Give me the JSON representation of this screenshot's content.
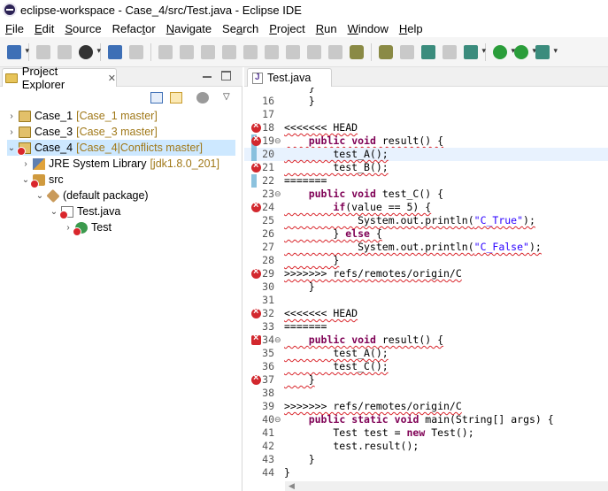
{
  "window": {
    "title": "eclipse-workspace - Case_4/src/Test.java - Eclipse IDE"
  },
  "menu": [
    {
      "mn": "F",
      "rest": "ile"
    },
    {
      "mn": "E",
      "rest": "dit"
    },
    {
      "mn": "S",
      "rest": "ource"
    },
    {
      "pre": "Refac",
      "mn": "t",
      "rest": "or"
    },
    {
      "mn": "N",
      "rest": "avigate"
    },
    {
      "pre": "Se",
      "mn": "a",
      "rest": "rch"
    },
    {
      "mn": "P",
      "rest": "roject"
    },
    {
      "mn": "R",
      "rest": "un"
    },
    {
      "mn": "W",
      "rest": "indow"
    },
    {
      "mn": "H",
      "rest": "elp"
    }
  ],
  "toolbar": {
    "icons": [
      "new-icon",
      "save-icon",
      "save-all-icon",
      "profile-icon",
      "terminal-icon",
      "skip-breakpoints-icon",
      "resume-icon",
      "suspend-icon",
      "terminate-icon",
      "disconnect-icon",
      "step-into-icon",
      "step-over-icon",
      "step-return-icon",
      "drop-to-frame-icon",
      "use-step-filters-icon",
      "open-type-icon",
      "toggle-mark-icon",
      "search-icon",
      "annotation-icon",
      "show-whitespace-icon",
      "debug-icon",
      "run-icon",
      "coverage-icon",
      "external-tools-icon"
    ]
  },
  "project_explorer": {
    "tab_label": "Project Explorer",
    "close_glyph": "✕",
    "tree": [
      {
        "depth": 0,
        "arrow": "›",
        "icon": "project-icon",
        "label": "Case_1",
        "decor": "[Case_1 master]"
      },
      {
        "depth": 0,
        "arrow": "›",
        "icon": "project-icon",
        "label": "Case_3",
        "decor": "[Case_3 master]"
      },
      {
        "depth": 0,
        "arrow": "⌄",
        "icon": "project-error-icon",
        "label": "Case_4",
        "decor": "[Case_4|Conflicts master]",
        "selected": true
      },
      {
        "depth": 1,
        "arrow": "›",
        "icon": "library-icon",
        "label": "JRE System Library",
        "decor": "[jdk1.8.0_201]"
      },
      {
        "depth": 1,
        "arrow": "⌄",
        "icon": "source-folder-icon",
        "label": "src",
        "decor": ""
      },
      {
        "depth": 2,
        "arrow": "⌄",
        "icon": "package-icon",
        "label": "(default package)",
        "decor": ""
      },
      {
        "depth": 3,
        "arrow": "⌄",
        "icon": "java-file-icon",
        "label": "Test.java",
        "decor": ""
      },
      {
        "depth": 4,
        "arrow": "›",
        "icon": "class-icon",
        "label": "Test",
        "decor": ""
      }
    ]
  },
  "editor": {
    "tab_label": "Test.java",
    "lines": [
      {
        "n": "",
        "text": "    }",
        "marker": ""
      },
      {
        "n": "16",
        "text": "    }",
        "marker": ""
      },
      {
        "n": "17",
        "text": "",
        "marker": ""
      },
      {
        "n": "18",
        "text": "<<<<<<< HEAD",
        "marker": "error",
        "style": "conflict"
      },
      {
        "n": "19",
        "text": "    public void result() {",
        "marker": "error-bar",
        "fold": "⊖"
      },
      {
        "n": "20",
        "text": "        test_A();",
        "marker": "bar",
        "cur": true
      },
      {
        "n": "21",
        "text": "        test_B();",
        "marker": "error"
      },
      {
        "n": "22",
        "text": "=======",
        "marker": "bar"
      },
      {
        "n": "23",
        "text": "    public void test_C() {",
        "marker": "",
        "fold": "⊖"
      },
      {
        "n": "24",
        "text": "        if(value == 5) {",
        "marker": "error"
      },
      {
        "n": "25",
        "text": "            System.out.println(\"C_True\");",
        "marker": ""
      },
      {
        "n": "26",
        "text": "        } else {",
        "marker": ""
      },
      {
        "n": "27",
        "text": "            System.out.println(\"C_False\");",
        "marker": ""
      },
      {
        "n": "28",
        "text": "        }",
        "marker": ""
      },
      {
        "n": "29",
        "text": ">>>>>>> refs/remotes/origin/C",
        "marker": "error",
        "style": "conflict"
      },
      {
        "n": "30",
        "text": "    }",
        "marker": ""
      },
      {
        "n": "31",
        "text": "",
        "marker": ""
      },
      {
        "n": "32",
        "text": "<<<<<<< HEAD",
        "marker": "error",
        "style": "conflict"
      },
      {
        "n": "33",
        "text": "=======",
        "marker": ""
      },
      {
        "n": "34",
        "text": "    public void result() {",
        "marker": "warn",
        "fold": "⊖"
      },
      {
        "n": "35",
        "text": "        test_A();",
        "marker": ""
      },
      {
        "n": "36",
        "text": "        test_C();",
        "marker": ""
      },
      {
        "n": "37",
        "text": "    }",
        "marker": "error"
      },
      {
        "n": "38",
        "text": "",
        "marker": ""
      },
      {
        "n": "39",
        "text": ">>>>>>> refs/remotes/origin/C",
        "marker": "",
        "style": "conflict"
      },
      {
        "n": "40",
        "text": "    public static void main(String[] args) {",
        "marker": "",
        "fold": "⊖"
      },
      {
        "n": "41",
        "text": "        Test test = new Test();",
        "marker": ""
      },
      {
        "n": "42",
        "text": "        test.result();",
        "marker": ""
      },
      {
        "n": "43",
        "text": "    }",
        "marker": ""
      },
      {
        "n": "44",
        "text": "}",
        "marker": ""
      }
    ]
  }
}
